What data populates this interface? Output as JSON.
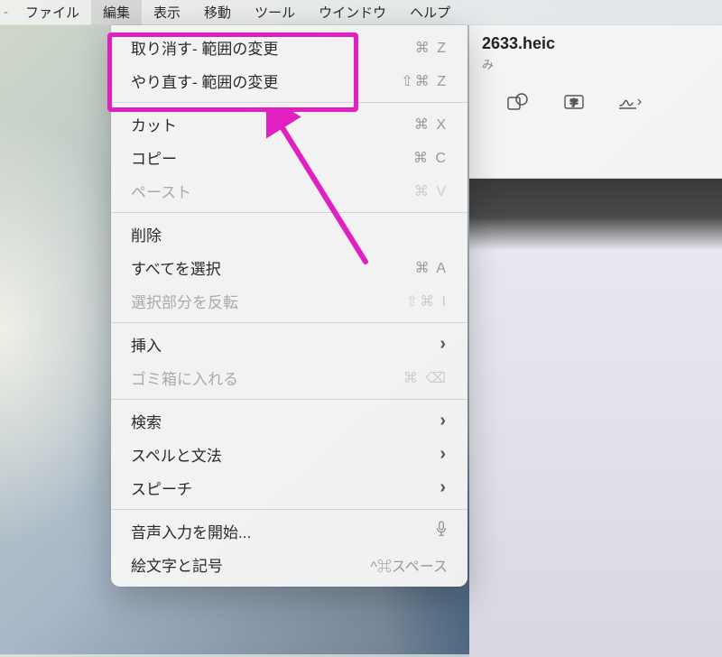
{
  "menubar": {
    "items": [
      {
        "label": "ファイル"
      },
      {
        "label": "編集"
      },
      {
        "label": "表示"
      },
      {
        "label": "移動"
      },
      {
        "label": "ツール"
      },
      {
        "label": "ウインドウ"
      },
      {
        "label": "ヘルプ"
      }
    ],
    "active_index": 1
  },
  "dropdown": {
    "groups": [
      [
        {
          "label": "取り消す- 範囲の変更",
          "shortcut": "⌘ Z",
          "enabled": true
        },
        {
          "label": "やり直す- 範囲の変更",
          "shortcut": "⇧⌘ Z",
          "enabled": true
        }
      ],
      [
        {
          "label": "カット",
          "shortcut": "⌘ X",
          "enabled": true
        },
        {
          "label": "コピー",
          "shortcut": "⌘ C",
          "enabled": true
        },
        {
          "label": "ペースト",
          "shortcut": "⌘ V",
          "enabled": false
        }
      ],
      [
        {
          "label": "削除",
          "shortcut": "",
          "enabled": true
        },
        {
          "label": "すべてを選択",
          "shortcut": "⌘ A",
          "enabled": true
        },
        {
          "label": "選択部分を反転",
          "shortcut": "⇧⌘ I",
          "enabled": false
        }
      ],
      [
        {
          "label": "挿入",
          "submenu": true,
          "enabled": true
        },
        {
          "label": "ゴミ箱に入れる",
          "shortcut": "⌘ ⌫",
          "enabled": false
        }
      ],
      [
        {
          "label": "検索",
          "submenu": true,
          "enabled": true
        },
        {
          "label": "スペルと文法",
          "submenu": true,
          "enabled": true
        },
        {
          "label": "スピーチ",
          "submenu": true,
          "enabled": true
        }
      ],
      [
        {
          "label": "音声入力を開始...",
          "mic": true,
          "enabled": true
        },
        {
          "label": "絵文字と記号",
          "shortcut": "^⌘スペース",
          "enabled": true
        }
      ]
    ]
  },
  "window": {
    "title": "2633.heic",
    "subtitle": "み"
  },
  "annotation": {
    "color": "#e020c0"
  }
}
